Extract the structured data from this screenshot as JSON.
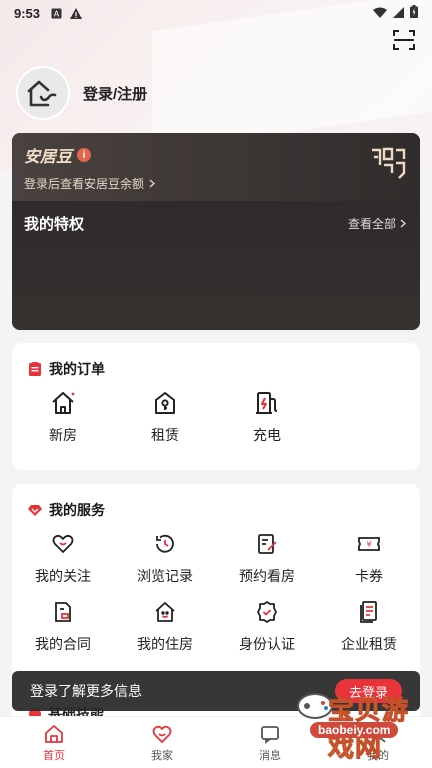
{
  "status_bar": {
    "time": "9:53"
  },
  "profile": {
    "login_label": "登录/注册"
  },
  "vip": {
    "bean_title": "安居豆",
    "bean_sub": "登录后查看安居豆余额",
    "privilege_title": "我的特权",
    "see_all": "查看全部"
  },
  "orders": {
    "title": "我的订单",
    "items": [
      {
        "label": "新房",
        "icon": "house-icon"
      },
      {
        "label": "租赁",
        "icon": "rental-key-icon"
      },
      {
        "label": "充电",
        "icon": "charging-station-icon"
      }
    ]
  },
  "services": {
    "title": "我的服务",
    "items": [
      {
        "label": "我的关注",
        "icon": "heart-icon"
      },
      {
        "label": "浏览记录",
        "icon": "history-icon"
      },
      {
        "label": "预约看房",
        "icon": "booking-icon"
      },
      {
        "label": "卡券",
        "icon": "coupon-icon"
      },
      {
        "label": "我的合同",
        "icon": "contract-icon"
      },
      {
        "label": "我的住房",
        "icon": "my-house-icon"
      },
      {
        "label": "身份认证",
        "icon": "verify-badge-icon"
      },
      {
        "label": "企业租赁",
        "icon": "enterprise-lease-icon"
      }
    ]
  },
  "peek_section": {
    "title": "基础技能"
  },
  "login_banner": {
    "text": "登录了解更多信息",
    "button": "去登录"
  },
  "tabbar": {
    "items": [
      {
        "label": "首页",
        "active": true
      },
      {
        "label": "我家",
        "active": false
      },
      {
        "label": "消息",
        "active": false
      },
      {
        "label": "我的",
        "active": false
      }
    ]
  },
  "watermark": {
    "cn": "宝贝游戏网",
    "en": "baobeiy.com"
  },
  "colors": {
    "accent": "#e9333a",
    "vip_dark": "#2f2c2b",
    "bean_gold": "#f4e0c9"
  }
}
